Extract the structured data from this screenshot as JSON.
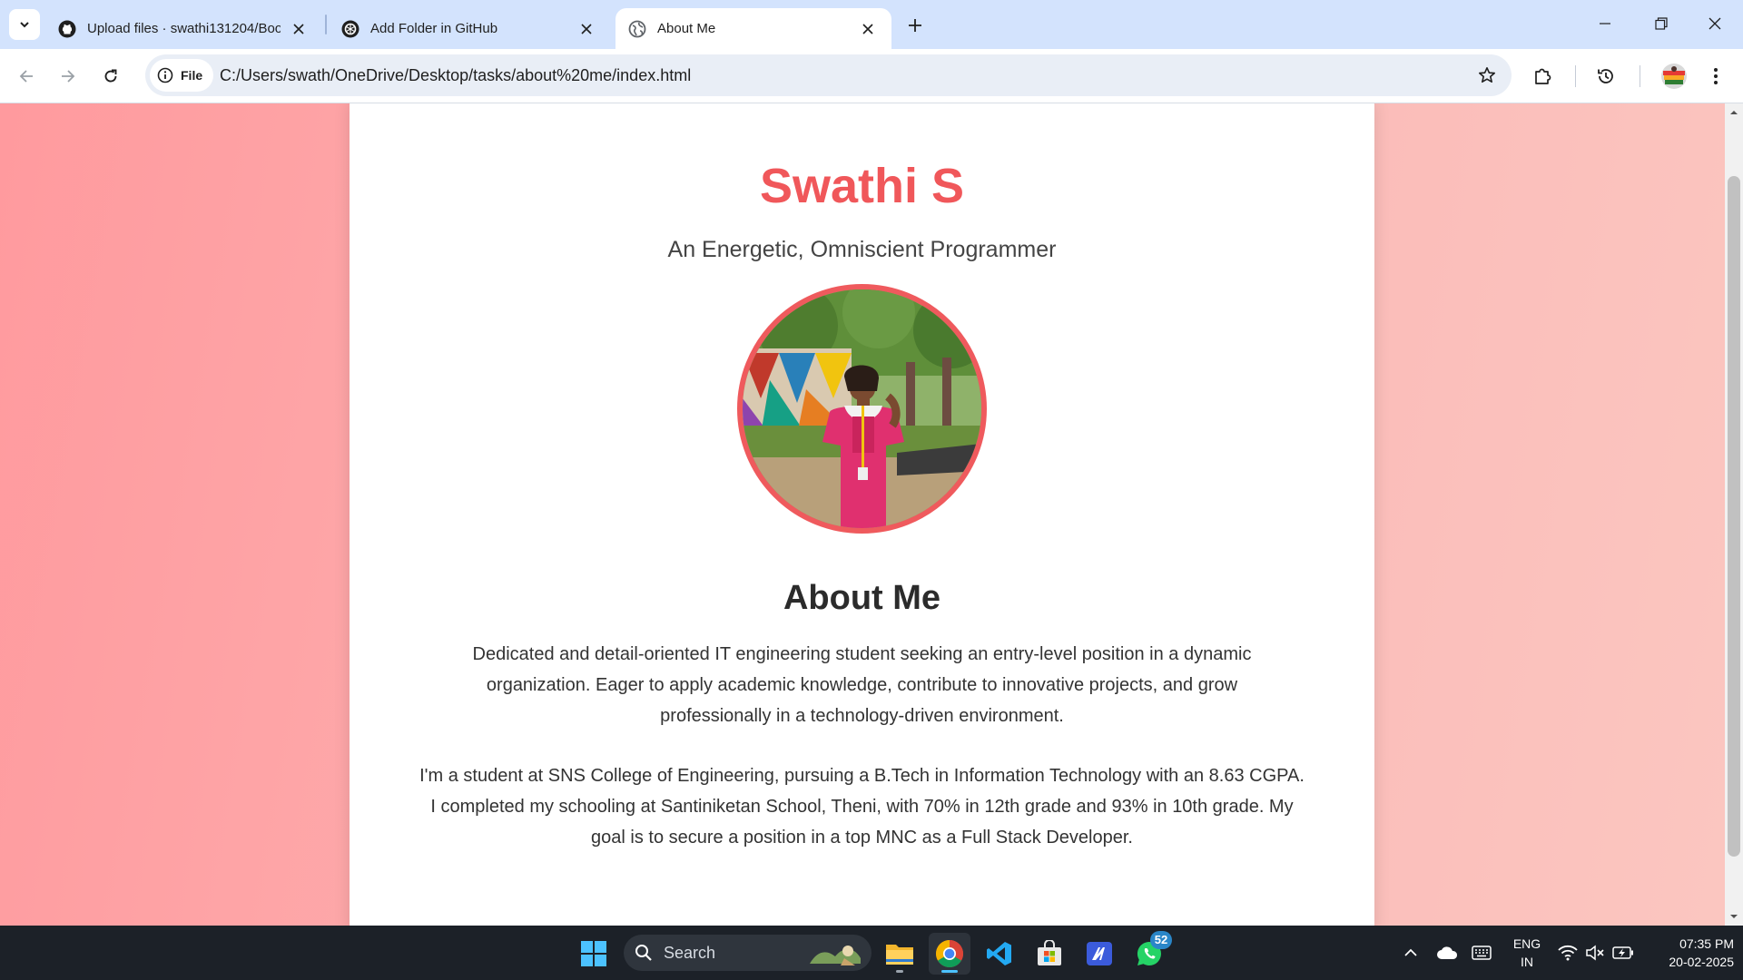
{
  "browser": {
    "tabs": [
      {
        "title": "Upload files · swathi131204/Bootc",
        "icon": "github-icon",
        "active": false
      },
      {
        "title": "Add Folder in GitHub",
        "icon": "openai-icon",
        "active": false
      },
      {
        "title": "About Me",
        "icon": "globe-icon",
        "active": true
      }
    ],
    "address": {
      "scheme_chip": "File",
      "url": "C:/Users/swath/OneDrive/Desktop/tasks/about%20me/index.html"
    }
  },
  "page": {
    "name": "Swathi S",
    "tagline": "An Energetic, Omniscient Programmer",
    "about_title": "About Me",
    "paragraphs": [
      "Dedicated and detail-oriented IT engineering student seeking an entry-level position in a dynamic organization. Eager to apply academic knowledge, contribute to innovative projects, and grow professionally in a technology-driven environment.",
      "I'm a student at SNS College of Engineering, pursuing a B.Tech in Information Technology with an 8.63 CGPA. I completed my schooling at Santiniketan School, Theni, with 70% in 12th grade and 93% in 10th grade. My goal is to secure a position in a top MNC as a Full Stack Developer."
    ],
    "colors": {
      "accent": "#f0575a",
      "background_start": "#ff9a9e",
      "background_end": "#fbc6c0"
    }
  },
  "taskbar": {
    "search_placeholder": "Search",
    "apps": [
      "windows-start-icon",
      "file-explorer-icon",
      "chrome-icon",
      "vscode-icon",
      "microsoft-store-icon",
      "editor-app-icon",
      "whatsapp-icon"
    ],
    "whatsapp_badge": "52",
    "language_line1": "ENG",
    "language_line2": "IN",
    "time": "07:35 PM",
    "date": "20-02-2025"
  }
}
